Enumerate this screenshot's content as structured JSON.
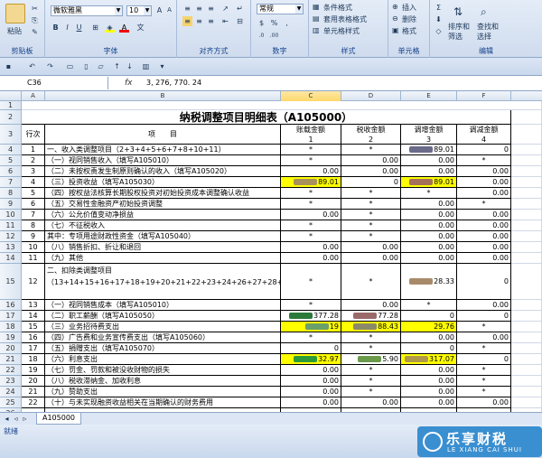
{
  "ribbon": {
    "paste": "粘贴",
    "font_name": "微软雅黑",
    "font_size": "10",
    "number_format": "常规",
    "cond_format": "条件格式",
    "table_format": "套用表格格式",
    "cell_style": "单元格样式",
    "insert": "插入",
    "delete": "删除",
    "format": "格式",
    "sort_filter": "排序和筛选",
    "find_select": "查找和选择",
    "groups": [
      "剪贴板",
      "字体",
      "对齐方式",
      "数字",
      "样式",
      "单元格",
      "编辑"
    ]
  },
  "formula_bar": {
    "cell_ref": "C36",
    "fx": "fx",
    "value": "3, 276, 770. 24"
  },
  "columns": [
    "A",
    "B",
    "C",
    "D",
    "E",
    "F"
  ],
  "sheet": {
    "title": "纳税调整项目明细表（A105000）",
    "header": {
      "hang": "行次",
      "item": "项　　目",
      "c": "账载金额",
      "d": "税收金额",
      "e": "调增金额",
      "f": "调减金额"
    },
    "colnums": [
      "1",
      "2",
      "3",
      "4"
    ]
  },
  "rows": [
    {
      "r": "4",
      "a": "1",
      "b": "一、收入类调整项目（2+3+4+5+6+7+8+10+11）",
      "c": "*",
      "d": "*",
      "e": "89.01",
      "f": "0"
    },
    {
      "r": "5",
      "a": "2",
      "b": "（一）视同销售收入（填写A105010）",
      "c": "*",
      "d": "0.00",
      "e": "0.00",
      "f": "*"
    },
    {
      "r": "6",
      "a": "3",
      "b": "（二）未按权责发生制原则确认的收入（填写A105020）",
      "c": "0.00",
      "d": "0.00",
      "e": "0.00",
      "f": "0.00"
    },
    {
      "r": "7",
      "a": "4",
      "b": "（三）投资收益（填写A105030）",
      "c": "89.01",
      "d": "0",
      "e": "89.01",
      "f": "0.00"
    },
    {
      "r": "8",
      "a": "5",
      "b": "（四）按权益法核算长期股权投资对初始投资成本调整确认收益",
      "c": "*",
      "d": "*",
      "e": "*",
      "f": "0.00"
    },
    {
      "r": "9",
      "a": "6",
      "b": "（五）交易性金融资产初始投资调整",
      "c": "*",
      "d": "*",
      "e": "0.00",
      "f": "*"
    },
    {
      "r": "10",
      "a": "7",
      "b": "（六）公允价值变动净损益",
      "c": "0.00",
      "d": "*",
      "e": "0.00",
      "f": "0.00"
    },
    {
      "r": "11",
      "a": "8",
      "b": "（七）不征税收入",
      "c": "*",
      "d": "*",
      "e": "0.00",
      "f": "0.00"
    },
    {
      "r": "12",
      "a": "9",
      "b": "其中：专项用途财政性资金（填写A105040）",
      "c": "*",
      "d": "*",
      "e": "0.00",
      "f": "0.00"
    },
    {
      "r": "13",
      "a": "10",
      "b": "（八）销售折扣、折让和退回",
      "c": "0.00",
      "d": "0.00",
      "e": "0.00",
      "f": "0.00"
    },
    {
      "r": "14",
      "a": "11",
      "b": "（九）其他",
      "c": "0.00",
      "d": "0.00",
      "e": "0.00",
      "f": "0.00"
    },
    {
      "r": "15",
      "a": "12",
      "b": "二、扣除类调整项目",
      "b2": "（13+14+15+16+17+18+19+20+21+22+23+24+26+27+28+29+30）",
      "c": "*",
      "d": "*",
      "e": "28.33",
      "f": "0",
      "tall": true
    },
    {
      "r": "16",
      "a": "13",
      "b": "（一）视同销售成本（填写A105010）",
      "c": "*",
      "d": "0.00",
      "e": "*",
      "f": "0.00"
    },
    {
      "r": "17",
      "a": "14",
      "b": "（二）职工薪酬（填写A105050）",
      "c": "377.28",
      "d": "77.28",
      "e": "0",
      "f": "0"
    },
    {
      "r": "18",
      "a": "15",
      "b": "（三）业务招待费支出",
      "c": "19",
      "d": "88.43",
      "e": "29.76",
      "f": "*"
    },
    {
      "r": "19",
      "a": "16",
      "b": "（四）广告费和业务宣传费支出（填写A105060）",
      "c": "*",
      "d": "*",
      "e": "0.00",
      "f": "0.00"
    },
    {
      "r": "20",
      "a": "17",
      "b": "（五）捐赠支出（填写A105070）",
      "c": "0",
      "d": "*",
      "e": "0",
      "f": "*"
    },
    {
      "r": "21",
      "a": "18",
      "b": "（六）利息支出",
      "c": "32.97",
      "d": "5.90",
      "e": "317.07",
      "f": "0"
    },
    {
      "r": "22",
      "a": "19",
      "b": "（七）罚金、罚款和被没收财物的损失",
      "c": "0.00",
      "d": "*",
      "e": "0.00",
      "f": "*"
    },
    {
      "r": "23",
      "a": "20",
      "b": "（八）税收滞纳金、加收利息",
      "c": "0.00",
      "d": "*",
      "e": "0.00",
      "f": "*"
    },
    {
      "r": "24",
      "a": "21",
      "b": "（九）赞助支出",
      "c": "0.00",
      "d": "*",
      "e": "0.00",
      "f": "*"
    },
    {
      "r": "25",
      "a": "22",
      "b": "（十）与未实现融资收益相关在当期确认的财务费用",
      "c": "0.00",
      "d": "0.00",
      "e": "0.00",
      "f": "0.00"
    },
    {
      "r": "26",
      "a": "",
      "b": "",
      "c": "",
      "d": "",
      "e": "",
      "f": ""
    }
  ],
  "tab": {
    "name": "A105000"
  },
  "status": {
    "text": "就绪"
  },
  "logo": {
    "cn": "乐享财税",
    "en": "LE XIANG CAI SHUI"
  },
  "colors": {
    "highlight": "#ffff00",
    "selected_col": "#ffd86b",
    "logo_bg": "#3a8fd0"
  }
}
